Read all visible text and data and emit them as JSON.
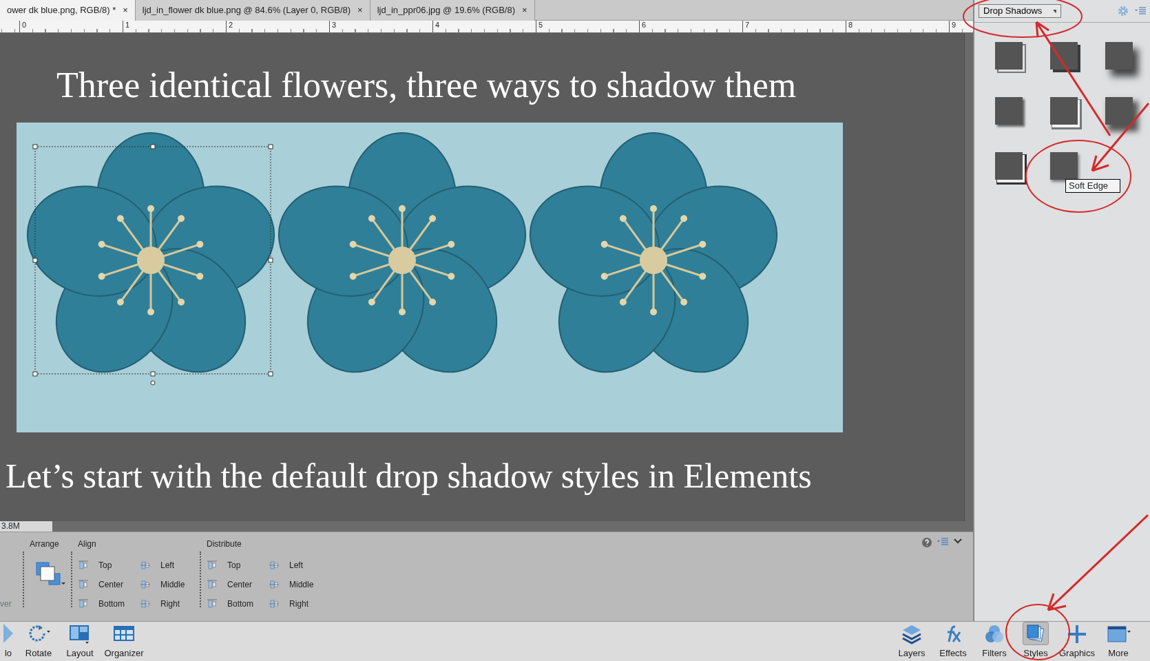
{
  "tabs": [
    {
      "label": "ower dk blue.png, RGB/8) *",
      "close": "×",
      "selected": true
    },
    {
      "label": "ljd_in_flower dk blue.png @ 84.6% (Layer 0, RGB/8)",
      "close": "×",
      "selected": false
    },
    {
      "label": "ljd_in_ppr06.jpg @ 19.6% (RGB/8)",
      "close": "×",
      "selected": false
    }
  ],
  "ruler": {
    "marks": [
      "0",
      "1",
      "2",
      "3",
      "4",
      "5",
      "6",
      "7",
      "8",
      "9"
    ]
  },
  "canvas": {
    "heading": "Three identical flowers, three ways to shadow them",
    "caption": "Let’s start with the default drop shadow styles in Elements"
  },
  "status_bar": {
    "doc_size": "3.8M"
  },
  "options": {
    "cut_label": "ver",
    "arrange": "Arrange",
    "align": {
      "label": "Align",
      "items": [
        "Top",
        "Left",
        "Center",
        "Middle",
        "Bottom",
        "Right"
      ]
    },
    "distribute": {
      "label": "Distribute",
      "items": [
        "Top",
        "Left",
        "Center",
        "Middle",
        "Bottom",
        "Right"
      ]
    }
  },
  "taskbar_left": [
    {
      "label": "lo",
      "kind": "redo"
    },
    {
      "label": "Rotate",
      "kind": "rotate"
    },
    {
      "label": "Layout",
      "kind": "layout"
    },
    {
      "label": "Organizer",
      "kind": "organizer"
    }
  ],
  "taskbar_right": [
    {
      "label": "Layers",
      "kind": "layers",
      "selected": false
    },
    {
      "label": "Effects",
      "kind": "effects",
      "selected": false
    },
    {
      "label": "Filters",
      "kind": "filters",
      "selected": false
    },
    {
      "label": "Styles",
      "kind": "styles",
      "selected": true
    },
    {
      "label": "Graphics",
      "kind": "graphics",
      "selected": false
    },
    {
      "label": "More",
      "kind": "more",
      "selected": false
    }
  ],
  "styles_panel": {
    "category": "Drop Shadows",
    "swatches": [
      {
        "kind": "outline"
      },
      {
        "kind": "hard"
      },
      {
        "kind": "soft"
      },
      {
        "kind": "low"
      },
      {
        "kind": "outline-light"
      },
      {
        "kind": "noisy"
      },
      {
        "kind": "outline-dark"
      },
      {
        "kind": "soft-edge"
      }
    ],
    "tooltip": "Soft Edge"
  }
}
